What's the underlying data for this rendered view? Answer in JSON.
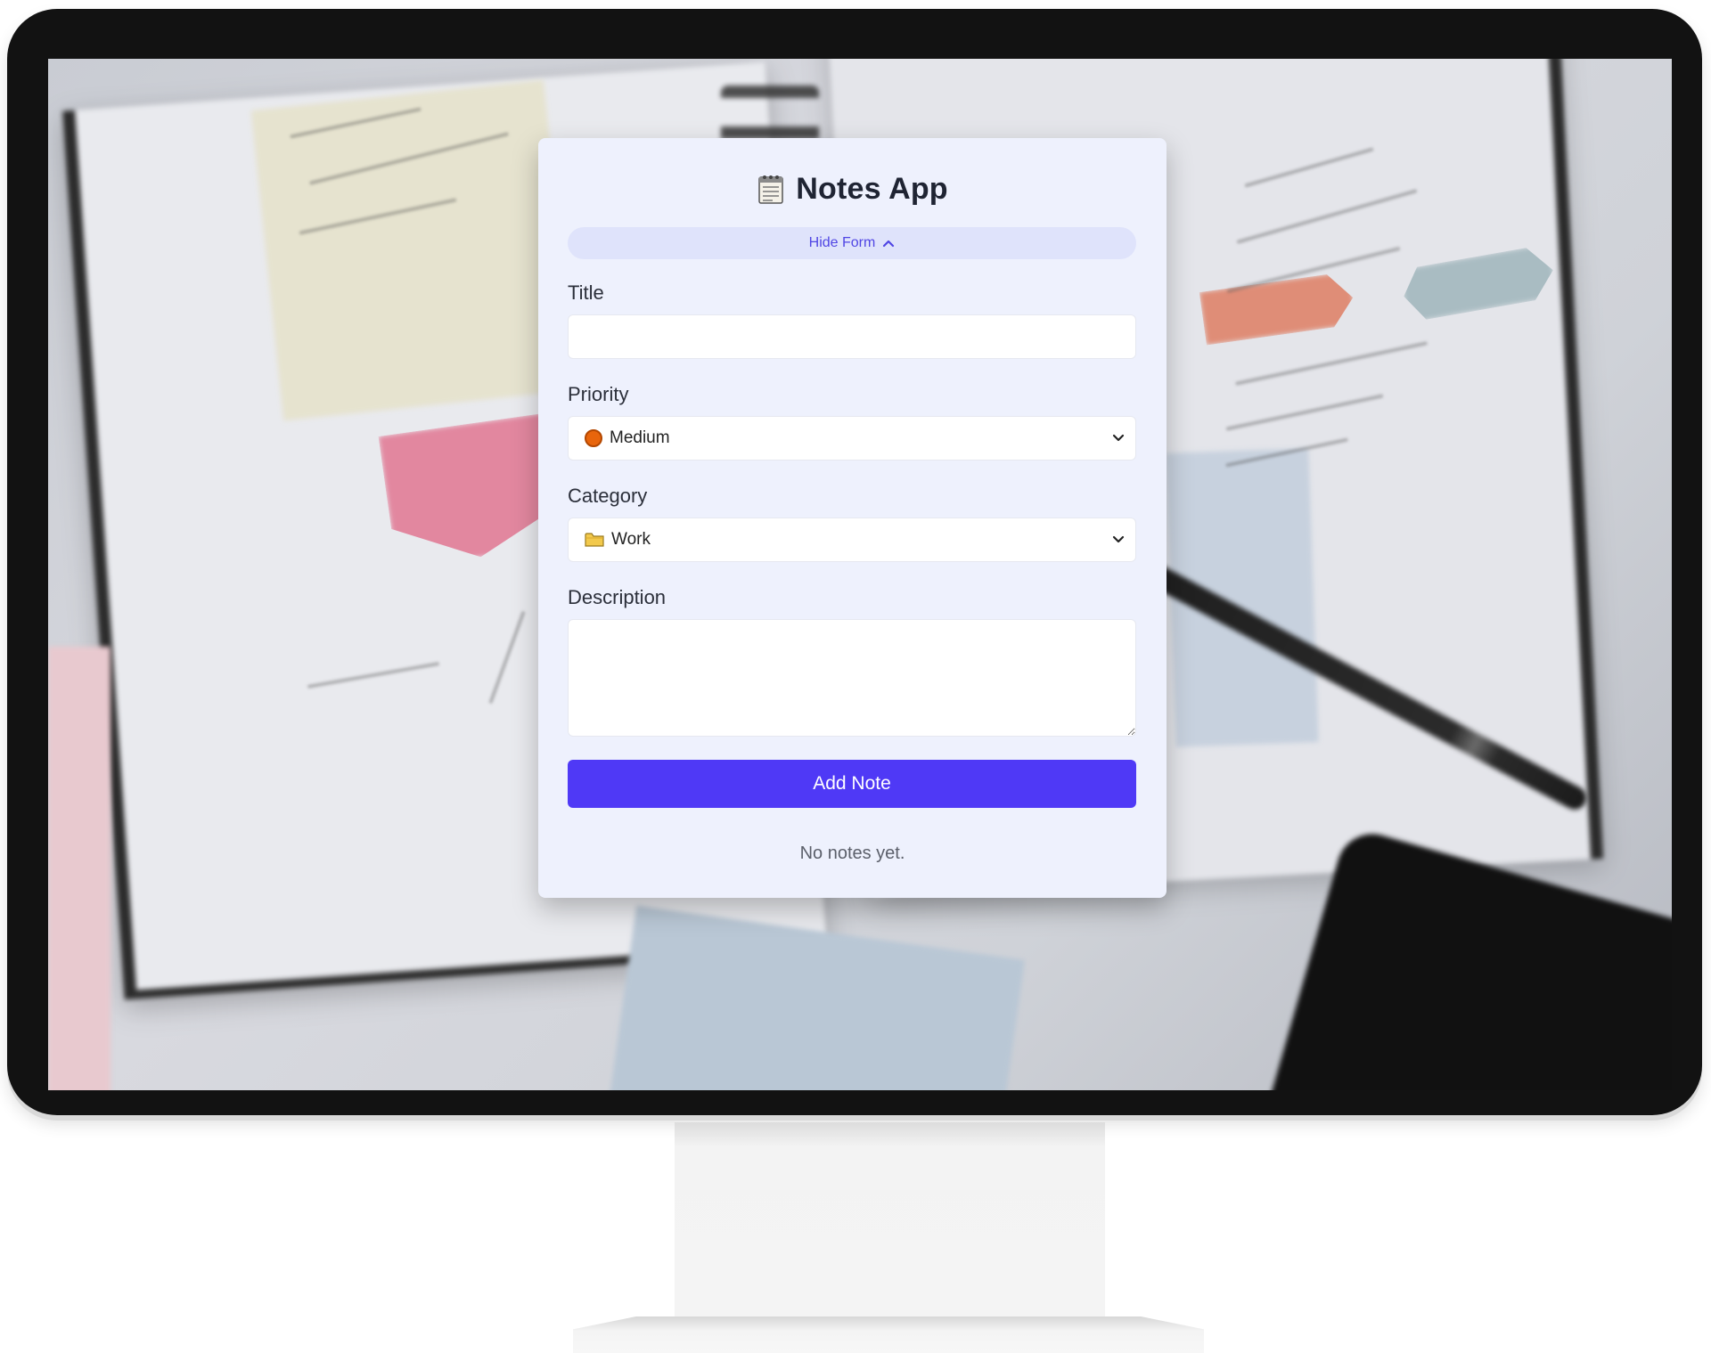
{
  "app": {
    "title": "Notes App",
    "toggle_form_label": "Hide Form",
    "icon": "notepad-icon"
  },
  "form": {
    "title_label": "Title",
    "title_value": "",
    "priority_label": "Priority",
    "priority_value": "Medium",
    "priority_icon": "orange-circle-icon",
    "priority_color": "#e8650c",
    "category_label": "Category",
    "category_value": "Work",
    "category_icon": "folder-icon",
    "description_label": "Description",
    "description_value": "",
    "submit_label": "Add Note"
  },
  "notes": {
    "empty_message": "No notes yet."
  },
  "colors": {
    "accent": "#4f39f6",
    "card_background": "#eef1fd",
    "toggle_background": "#dfe3fb",
    "toggle_text": "#5046e4"
  }
}
